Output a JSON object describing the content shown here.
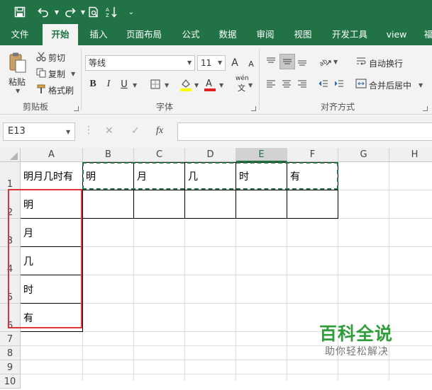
{
  "qat": {
    "save_icon": "save-icon",
    "undo_icon": "undo-icon",
    "redo_icon": "redo-icon",
    "print_preview_icon": "print-preview-icon",
    "sort_icon": "sort-icon",
    "customize_icon": "customize-qat-icon"
  },
  "tabs": [
    {
      "label": "文件"
    },
    {
      "label": "开始",
      "active": true
    },
    {
      "label": "插入"
    },
    {
      "label": "页面布局"
    },
    {
      "label": "公式"
    },
    {
      "label": "数据"
    },
    {
      "label": "审阅"
    },
    {
      "label": "视图"
    },
    {
      "label": "开发工具"
    },
    {
      "label": "view"
    },
    {
      "label": "福"
    }
  ],
  "ribbon": {
    "clipboard": {
      "paste": "粘贴",
      "cut": "剪切",
      "copy": "复制",
      "format_painter": "格式刷",
      "group_label": "剪贴板"
    },
    "font": {
      "font_name": "等线",
      "font_size": "11",
      "bold": "B",
      "italic": "I",
      "underline": "U",
      "increase_size": "A",
      "decrease_size": "A",
      "phonetic_top": "wén",
      "phonetic_bottom": "文",
      "group_label": "字体"
    },
    "alignment": {
      "wrap_text": "自动换行",
      "merge_center": "合并后居中",
      "group_label": "对齐方式"
    }
  },
  "formula_bar": {
    "name_box": "E13",
    "cancel": "✕",
    "enter": "✓",
    "fx": "fx",
    "value": ""
  },
  "sheet": {
    "columns": [
      "A",
      "B",
      "C",
      "D",
      "E",
      "F",
      "G",
      "H"
    ],
    "selected_column": "E",
    "rows": [
      "1",
      "2",
      "3",
      "4",
      "5",
      "6",
      "7",
      "8",
      "9",
      "10"
    ],
    "cells": {
      "A1": "明月几时有",
      "A2": "明",
      "A3": "月",
      "A4": "几",
      "A5": "时",
      "A6": "有",
      "B1": "明",
      "C1": "月",
      "D1": "几",
      "E1": "时",
      "F1": "有"
    }
  },
  "watermark": {
    "title": "百科全说",
    "subtitle": "助你轻松解决"
  },
  "colors": {
    "excel_green": "#217346",
    "copy_marquee": "#217346",
    "highlight_box": "#d9353b",
    "watermark_green": "#2f9e3a"
  }
}
